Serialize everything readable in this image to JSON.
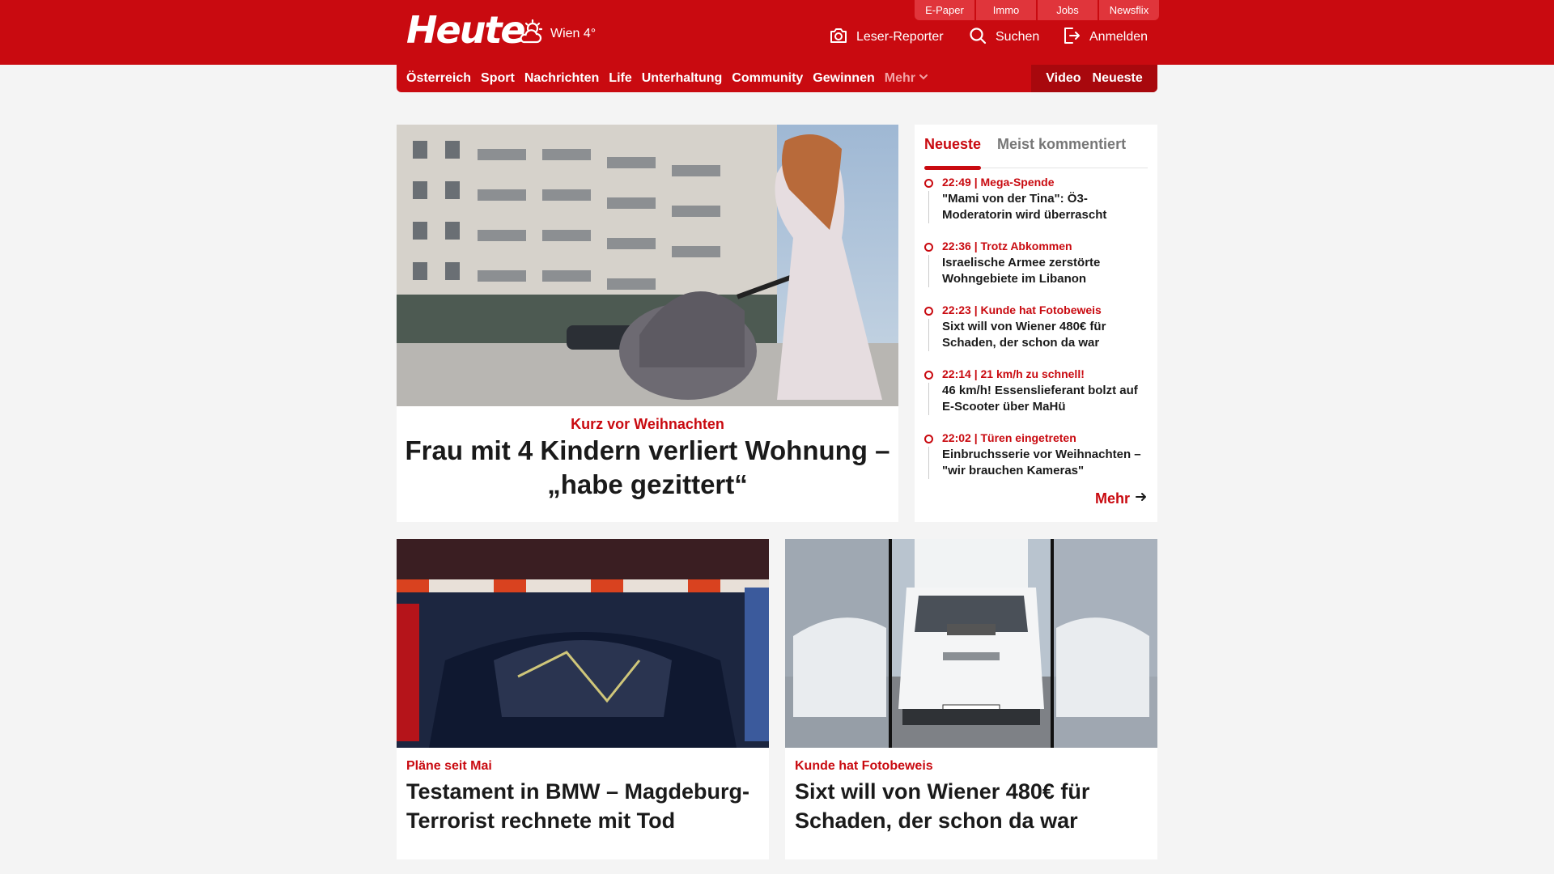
{
  "header": {
    "logo": "Heute",
    "weather": "Wien 4°",
    "top_tabs": [
      "E-Paper",
      "Immo",
      "Jobs",
      "Newsflix"
    ],
    "leser_reporter": "Leser-Reporter",
    "search": "Suchen",
    "login": "Anmelden"
  },
  "nav": {
    "items": [
      "Österreich",
      "Sport",
      "Nachrichten",
      "Life",
      "Unterhaltung",
      "Community",
      "Gewinnen"
    ],
    "more": "Mehr",
    "video": "Video",
    "newest": "Neueste"
  },
  "hero": {
    "kicker": "Kurz vor Weihnachten",
    "title": "Frau mit 4 Kindern verliert Wohnung – „habe gezittert“"
  },
  "sidebar": {
    "tabs": [
      "Neueste",
      "Meist kommentiert"
    ],
    "items": [
      {
        "time": "22:49 | Mega-Spende",
        "title": "\"Mami von der Tina\": Ö3-Moderatorin wird überrascht"
      },
      {
        "time": "22:36 | Trotz Abkommen",
        "title": "Israelische Armee zerstörte Wohngebiete im Libanon"
      },
      {
        "time": "22:23 | Kunde hat Fotobeweis",
        "title": "Sixt will von Wiener 480€ für Schaden, der schon da war"
      },
      {
        "time": "22:14 | 21 km/h zu schnell!",
        "title": "46 km/h! Essenslieferant bolzt auf E-Scooter über MaHü"
      },
      {
        "time": "22:02 | Türen eingetreten",
        "title": "Einbruchsserie vor Weihnachten – \"wir brauchen Kameras\""
      }
    ],
    "more": "Mehr"
  },
  "cards": [
    {
      "kicker": "Pläne seit Mai",
      "title": "Testament in BMW – Magdeburg-Terrorist rechnete mit Tod"
    },
    {
      "kicker": "Kunde hat Fotobeweis",
      "title": "Sixt will von Wiener 480€ für Schaden, der schon da war"
    }
  ],
  "icons": {
    "weather": "cloud-sun-icon",
    "camera": "camera-icon",
    "search": "search-icon",
    "login": "login-icon",
    "chevron": "chevron-down-icon",
    "arrow": "arrow-right-icon"
  },
  "colors": {
    "brand_red": "#c90a10",
    "tab_red": "#e0353b",
    "page_bg": "#f4f4f4"
  }
}
